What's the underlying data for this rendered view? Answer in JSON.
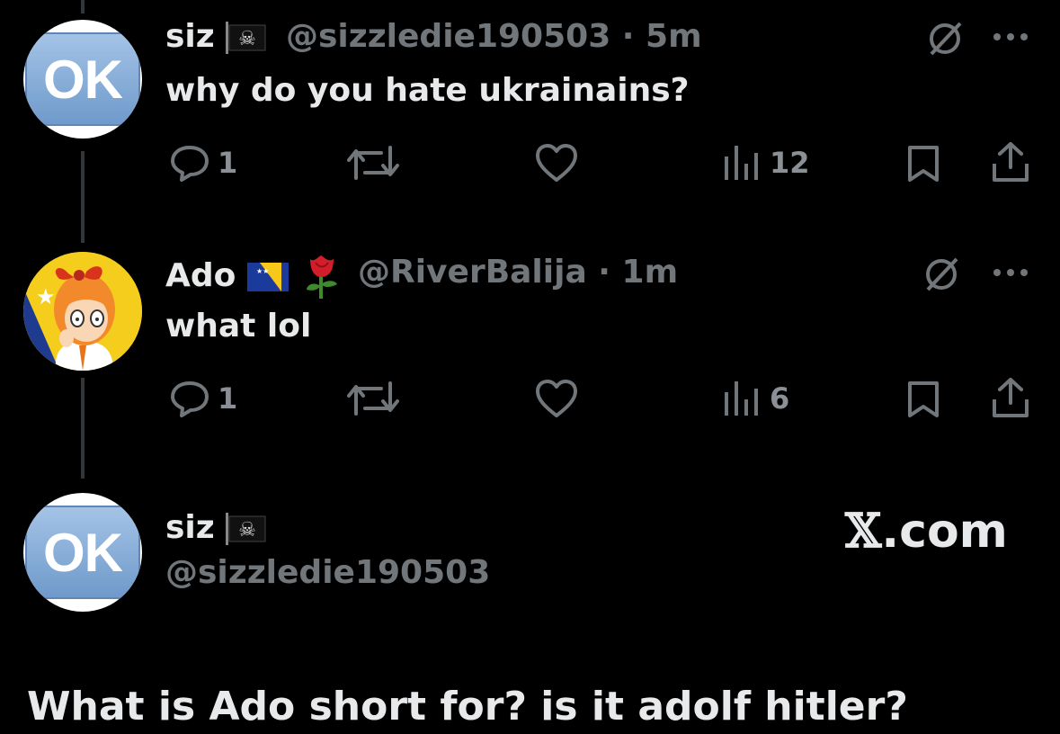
{
  "tweets": [
    {
      "name": "siz",
      "name_emoji": "pirate-flag",
      "handle": "@sizzledie190503",
      "time": "5m",
      "text": "why do you hate ukrainains?",
      "replies": "1",
      "views": "12",
      "avatar": "ok-button"
    },
    {
      "name": "Ado",
      "name_emoji": "bosnia-flag rose",
      "handle": "@RiverBalija",
      "time": "1m",
      "text": "what lol",
      "replies": "1",
      "views": "6",
      "avatar": "anime-girl"
    }
  ],
  "quoted": {
    "name": "siz",
    "handle": "@sizzledie190503",
    "text": "What is Ado short for? is it adolf hitler?",
    "avatar": "ok-button"
  },
  "avatar_labels": {
    "ok": "OK"
  },
  "separator": "·",
  "watermark": {
    "x": "𝕏",
    "suffix": ".com"
  },
  "colors": {
    "background": "#000000",
    "primary_text": "#e7e9ea",
    "secondary_text": "#71767b",
    "thread_line": "#333639"
  }
}
